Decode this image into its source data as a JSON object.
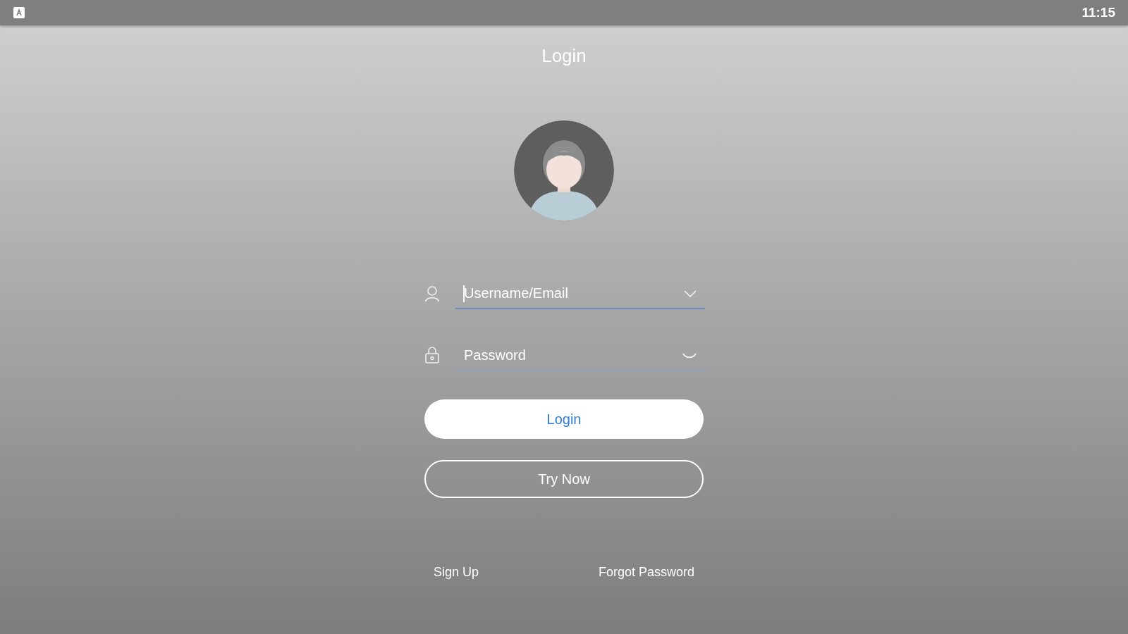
{
  "status_bar": {
    "time": "11:15"
  },
  "title": "Login",
  "fields": [
    {
      "kind": "username",
      "placeholder": "Username/Email",
      "focused": true
    },
    {
      "kind": "password",
      "placeholder": "Password",
      "focused": false
    }
  ],
  "buttons": [
    {
      "kind": "filled",
      "label": "Login"
    },
    {
      "kind": "outline",
      "label": "Try Now"
    }
  ],
  "links": [
    "Sign Up",
    "Forgot Password"
  ]
}
